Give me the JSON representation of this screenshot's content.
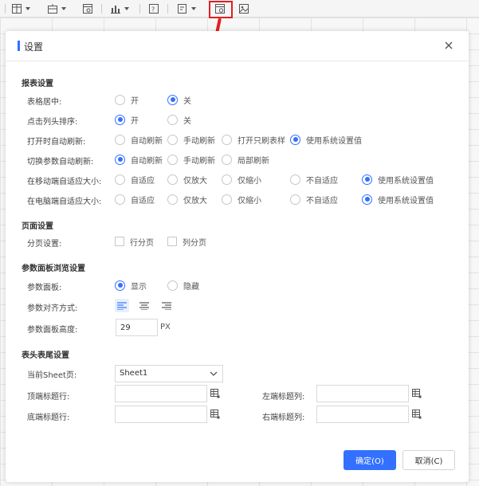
{
  "dialog": {
    "title": "设置",
    "ok_label": "确定(O)",
    "cancel_label": "取消(C)"
  },
  "report": {
    "title": "报表设置",
    "table_center": {
      "label": "表格居中:",
      "options": [
        "开",
        "关"
      ],
      "selected": "关"
    },
    "header_sort": {
      "label": "点击列头排序:",
      "options": [
        "开",
        "关"
      ],
      "selected": "开"
    },
    "auto_refresh_open": {
      "label": "打开时自动刷新:",
      "options": [
        "自动刷新",
        "手动刷新",
        "打开只刷表样",
        "使用系统设置值"
      ],
      "selected": "使用系统设置值"
    },
    "param_refresh": {
      "label": "切换参数自动刷新:",
      "options": [
        "自动刷新",
        "手动刷新",
        "局部刷新"
      ],
      "selected": "自动刷新"
    },
    "mobile_fit": {
      "label": "在移动端自适应大小:",
      "options": [
        "自适应",
        "仅放大",
        "仅缩小",
        "不自适应",
        "使用系统设置值"
      ],
      "selected": "使用系统设置值"
    },
    "pc_fit": {
      "label": "在电脑端自适应大小:",
      "options": [
        "自适应",
        "仅放大",
        "仅缩小",
        "不自适应",
        "使用系统设置值"
      ],
      "selected": "使用系统设置值"
    }
  },
  "page": {
    "title": "页面设置",
    "paging": {
      "label": "分页设置:",
      "options": [
        "行分页",
        "列分页"
      ]
    }
  },
  "param_panel": {
    "title": "参数面板浏览设置",
    "panel": {
      "label": "参数面板:",
      "options": [
        "显示",
        "隐藏"
      ],
      "selected": "显示"
    },
    "align": {
      "label": "参数对齐方式:",
      "selected": "left"
    },
    "height": {
      "label": "参数面板高度:",
      "value": "29",
      "unit": "PX"
    }
  },
  "header_footer": {
    "title": "表头表尾设置",
    "sheet": {
      "label": "当前Sheet页:",
      "value": "Sheet1"
    },
    "top_row": {
      "label": "顶端标题行:",
      "value": ""
    },
    "bottom_row": {
      "label": "底端标题行:",
      "value": ""
    },
    "left_col": {
      "label": "左端标题列:",
      "value": ""
    },
    "right_col": {
      "label": "右端标题列:",
      "value": ""
    }
  },
  "colors": {
    "accent": "#3370ff",
    "highlight": "#e02020"
  }
}
